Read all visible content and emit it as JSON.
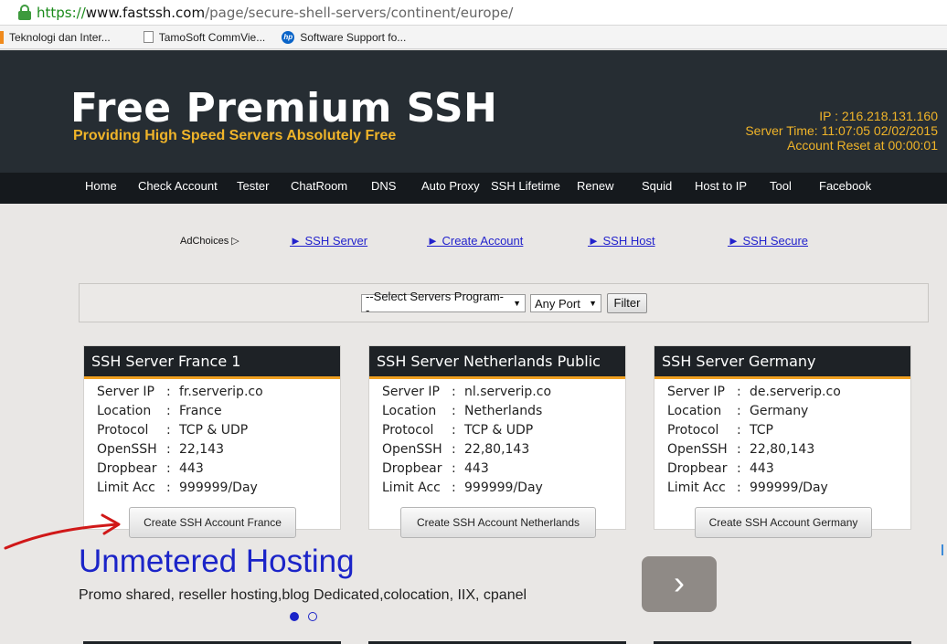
{
  "browser": {
    "url_scheme": "https://",
    "url_host": "www.fastssh.com",
    "url_path": "/page/secure-shell-servers/continent/europe/",
    "bookmarks": [
      {
        "label": "Teknologi dan Inter...",
        "icon": "orange-bookmark-icon"
      },
      {
        "label": "TamoSoft CommVie...",
        "icon": "page-icon"
      },
      {
        "label": "Software Support fo...",
        "icon": "hp-logo-icon"
      }
    ]
  },
  "site": {
    "title": "Free Premium SSH",
    "tagline": "Providing High Speed Servers Absolutely Free",
    "ip": "IP : 216.218.131.160",
    "server_time": "Server Time: 11:07:05 02/02/2015",
    "account_reset": "Account Reset at 00:00:01"
  },
  "nav": {
    "items": [
      "Home",
      "Check Account",
      "Tester",
      "ChatRoom",
      "DNS",
      "Auto Proxy",
      "SSH Lifetime",
      "Renew",
      "Squid",
      "Host to IP",
      "Tool",
      "Facebook"
    ]
  },
  "ads": {
    "adchoices": "AdChoices",
    "links": [
      "► SSH Server",
      "► Create Account",
      "► SSH Host",
      "► SSH Secure"
    ]
  },
  "filter": {
    "program_select": "--Select Servers Program--",
    "port_select": "Any Port",
    "button": "Filter"
  },
  "cards": [
    {
      "title": "SSH Server France 1",
      "rows": [
        {
          "key": "Server IP",
          "value": "fr.serverip.co"
        },
        {
          "key": "Location",
          "value": "France"
        },
        {
          "key": "Protocol",
          "value": "TCP & UDP"
        },
        {
          "key": "OpenSSH",
          "value": "22,143"
        },
        {
          "key": "Dropbear",
          "value": "443"
        },
        {
          "key": "Limit Acc",
          "value": "999999/Day"
        }
      ],
      "button": "Create SSH Account France"
    },
    {
      "title": "SSH Server Netherlands Public",
      "rows": [
        {
          "key": "Server IP",
          "value": "nl.serverip.co"
        },
        {
          "key": "Location",
          "value": "Netherlands"
        },
        {
          "key": "Protocol",
          "value": "TCP & UDP"
        },
        {
          "key": "OpenSSH",
          "value": "22,80,143"
        },
        {
          "key": "Dropbear",
          "value": "443"
        },
        {
          "key": "Limit Acc",
          "value": "999999/Day"
        }
      ],
      "button": "Create SSH Account Netherlands"
    },
    {
      "title": "SSH Server Germany",
      "rows": [
        {
          "key": "Server IP",
          "value": "de.serverip.co"
        },
        {
          "key": "Location",
          "value": "Germany"
        },
        {
          "key": "Protocol",
          "value": "TCP"
        },
        {
          "key": "OpenSSH",
          "value": "22,80,143"
        },
        {
          "key": "Dropbear",
          "value": "443"
        },
        {
          "key": "Limit Acc",
          "value": "999999/Day"
        }
      ],
      "button": "Create SSH Account Germany"
    }
  ],
  "banner": {
    "title": "Unmetered Hosting",
    "description": "Promo shared, reseller hosting,blog Dedicated,colocation, IIX, cpanel",
    "next_glyph": "›"
  },
  "colors": {
    "header_bg": "#262d33",
    "nav_bg": "#15191d",
    "accent_gold": "#f0b429",
    "card_accent": "#f0a020",
    "link_blue": "#2222cc"
  }
}
